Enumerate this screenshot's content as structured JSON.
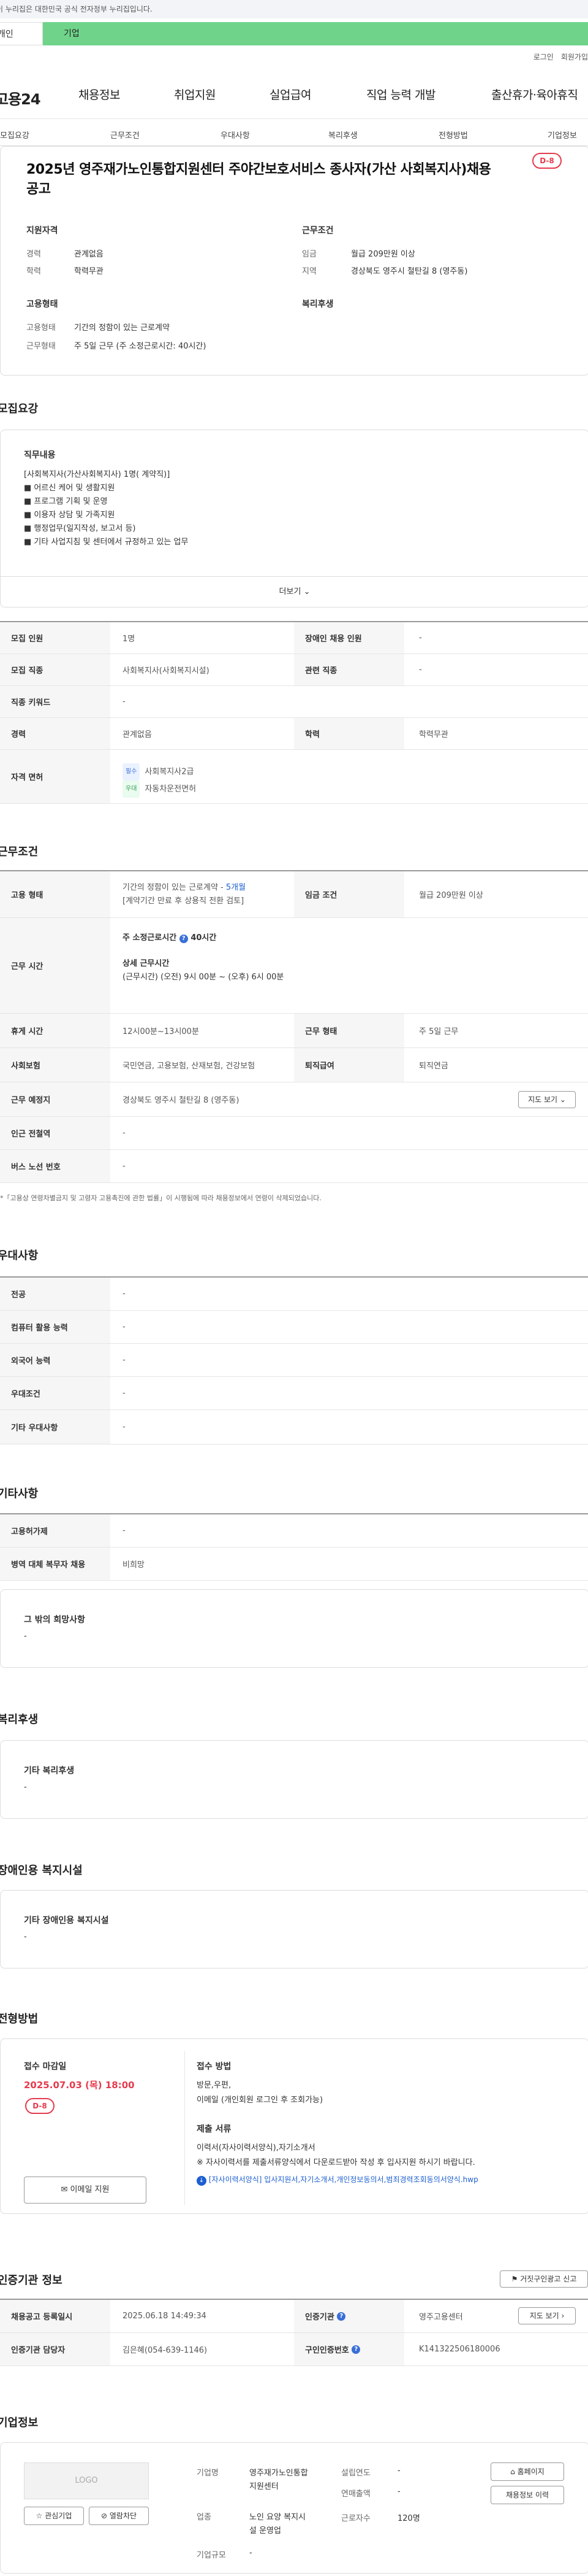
{
  "gov_notice": "이 누리집은 대한민국 공식 전자정부 누리집입니다.",
  "top_tabs": {
    "active": "개인",
    "other": "기업"
  },
  "util": {
    "login": "로그인",
    "join": "회원가입"
  },
  "logo": "고용24",
  "gnb": [
    "채용정보",
    "취업지원",
    "실업급여",
    "직업 능력 개발",
    "출산휴가·육아휴직"
  ],
  "subnav": [
    "모집요강",
    "근무조건",
    "우대사항",
    "복리후생",
    "전형방법",
    "기업정보"
  ],
  "job": {
    "title": "2025년 영주재가노인통합지원센터 주야간보호서비스 종사자(가산 사회복지사)채용 공고",
    "dday": "D-8",
    "summary": {
      "req_h": "지원자격",
      "career_k": "경력",
      "career_v": "관계없음",
      "edu_k": "학력",
      "edu_v": "학력무관",
      "cond_h": "근무조건",
      "wage_k": "임금",
      "wage_v": "월급 209만원 이상",
      "loc_k": "지역",
      "loc_v": "경상북도 영주시 철탄길 8 (영주동)",
      "emp_h": "고용형태",
      "emptype_k": "고용형태",
      "emptype_v": "기간의 정함이 있는 근로계약",
      "worktype_k": "근무형태",
      "worktype_v": "주 5일 근무 (주 소정근로시간: 40시간)",
      "welfare_h": "복리후생"
    }
  },
  "recruit": {
    "heading": "모집요강",
    "duty_h": "직무내용",
    "duty_lines": [
      "[사회복지사(가산사회복지사) 1명( 계약직)]",
      "■ 어르신 케어 및 생활지원",
      "■ 프로그램 기획 및  운영",
      "■ 이용자 상담 및 가족지원",
      "■ 행정업무(일지작성, 보고서 등)",
      "■ 기타 사업지침 및 센터에서 규정하고 있는 업무"
    ],
    "more": "더보기",
    "rows": {
      "count_k": "모집 인원",
      "count_v": "1명",
      "disabled_k": "장애인 채용 인원",
      "disabled_v": "-",
      "job_k": "모집 직종",
      "job_v": "사회복지사(사회복지시설)",
      "related_k": "관련 직종",
      "related_v": "-",
      "kw_k": "직종 키워드",
      "kw_v": "-",
      "career_k": "경력",
      "career_v": "관계없음",
      "edu_k": "학력",
      "edu_v": "학력무관",
      "license_k": "자격 면허",
      "lic1_tag": "필수",
      "lic1": "사회복지사2급",
      "lic2_tag": "우대",
      "lic2": "자동차운전면허"
    }
  },
  "work": {
    "heading": "근무조건",
    "emp_k": "고용 형태",
    "emp_v1": "기간의 정함이 있는 근로계약 - ",
    "emp_v1b": "5개월",
    "emp_v2": "[계약기간 만료 후 상용직 전환 검토]",
    "wage_k": "임금 조건",
    "wage_v": "월급 209만원 이상",
    "hours_k": "근무 시간",
    "hours_sub1": "주 소정근로시간",
    "hours_total": "40시간",
    "hours_sub2": "상세 근무시간",
    "hours_detail": "(근무시간) (오전) 9시 00분 ~ (오후) 6시 00분",
    "rest_k": "휴게 시간",
    "rest_v": "12시00분~13시00분",
    "form_k": "근무 형태",
    "form_v": "주 5일 근무",
    "ins_k": "사회보험",
    "ins_v": "국민연금, 고용보험, 산재보험, 건강보험",
    "retire_k": "퇴직급여",
    "retire_v": "퇴직연금",
    "loc_k": "근무 예정지",
    "loc_v": "경상북도 영주시 철탄길 8 (영주동)",
    "map_btn": "지도 보기",
    "subway_k": "인근 전철역",
    "subway_v": "-",
    "bus_k": "버스 노선 번호",
    "bus_v": "-",
    "note": "*「고용상 연령차별금지 및 고령자 고용촉진에 관한 법률」이 시행됨에 따라 채용정보에서 연령이 삭제되었습니다."
  },
  "pref": {
    "heading": "우대사항",
    "rows": [
      {
        "k": "전공",
        "v": "-"
      },
      {
        "k": "컴퓨터 활용 능력",
        "v": "-"
      },
      {
        "k": "외국어 능력",
        "v": "-"
      },
      {
        "k": "우대조건",
        "v": "-"
      },
      {
        "k": "기타 우대사항",
        "v": "-"
      }
    ]
  },
  "etc": {
    "heading": "기타사항",
    "emp_k": "고용허가제",
    "emp_v": "-",
    "mil_k": "병역 대체 복무자 채용",
    "mil_v": "비희망",
    "other_h": "그 밖의 희망사항",
    "other_v": "-"
  },
  "welfare": {
    "heading": "복리후생",
    "h": "기타 복리후생",
    "v": "-"
  },
  "disab": {
    "heading": "장애인용 복지시설",
    "h": "기타 장애인용 복지시설",
    "v": "-"
  },
  "apply": {
    "heading": "전형방법",
    "deadline_h": "접수 마감일",
    "deadline_v": "2025.07.03 (목) 18:00",
    "dday": "D-8",
    "apply_btn": "이메일 지원",
    "method_h": "접수 방법",
    "method_v1": "방문,우편,",
    "method_v2": "이메일 (개인회원 로그인 후 조회가능)",
    "doc_h": "제출 서류",
    "doc_v1": "이력서(자사이력서양식),자기소개서",
    "doc_v2": "※ 자사이력서를 제출서류양식에서 다운로드받아 작성 후 입사지원 하시기 바랍니다.",
    "doc_link": "[자사이력서양식] 입사지원서,자기소개서,개인정보동의서,범죄경력조회동의서양식.hwp"
  },
  "cert": {
    "heading": "인증기관 정보",
    "report_btn": "거짓구인광고 신고",
    "reg_k": "채용공고 등록일시",
    "reg_v": "2025.06.18 14:49:34",
    "org_k": "인증기관",
    "org_v": "영주고용센터",
    "map_btn": "지도 보기",
    "mgr_k": "인증기관 담당자",
    "mgr_v": "김은혜(054-639-1146)",
    "id_k": "구인인증번호",
    "id_v": "K141322506180006"
  },
  "company": {
    "heading": "기업정보",
    "logo": "LOGO",
    "fav_btn": "관심기업",
    "block_btn": "열람차단",
    "name_k": "기업명",
    "name_v1": "영주재가노인통합",
    "name_v2": "지원센터",
    "founded_k": "설립연도",
    "founded_v": "-",
    "sales_k": "연매출액",
    "sales_v": "-",
    "biz_k": "업종",
    "biz_v1": "노인 요양 복지시",
    "biz_v2": "설 운영업",
    "staff_k": "근로자수",
    "staff_v": "120명",
    "size_k": "기업규모",
    "size_v": "-",
    "home_btn": "홈페이지",
    "jobs_btn": "채용정보 이력"
  },
  "colors": {
    "accent_green": "#6fd48a",
    "dday_red": "#e63b4d",
    "link_blue": "#1d5fd1"
  }
}
